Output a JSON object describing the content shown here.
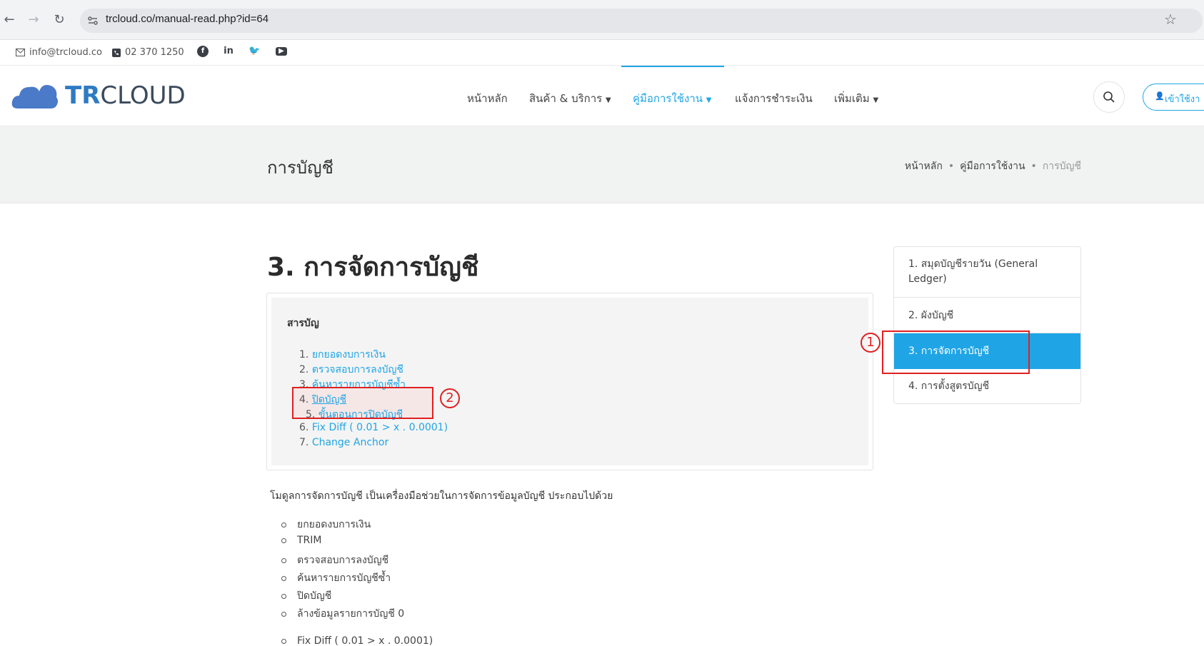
{
  "browser": {
    "url": "trcloud.co/manual-read.php?id=64"
  },
  "topbar": {
    "email": "info@trcloud.co",
    "phone": "02 370 1250",
    "social_icons": [
      "facebook-icon",
      "linkedin-icon",
      "twitter-icon",
      "youtube-icon"
    ]
  },
  "header": {
    "logo_tr": "TR",
    "logo_cloud": "CLOUD",
    "menu": [
      {
        "label": "หน้าหลัก",
        "dropdown": false
      },
      {
        "label": "สินค้า & บริการ",
        "dropdown": true
      },
      {
        "label": "คู่มือการใช้งาน",
        "dropdown": true,
        "active": true
      },
      {
        "label": "แจ้งการชำระเงิน",
        "dropdown": false
      },
      {
        "label": "เพิ่มเติม",
        "dropdown": true
      }
    ],
    "login_label": "เข้าใช้งา"
  },
  "page": {
    "title": "การบัญชี",
    "breadcrumb": [
      "หน้าหลัก",
      "คู่มือการใช้งาน",
      "การบัญชี"
    ]
  },
  "main": {
    "heading": "3. การจัดการบัญชี",
    "toc_title": "สารบัญ",
    "toc": [
      {
        "num": "1.",
        "label": "ยกยอดงบการเงิน"
      },
      {
        "num": "2.",
        "label": "ตรวจสอบการลงบัญชี"
      },
      {
        "num": "3.",
        "label": "ค้นหารายการบัญชีซ้ำ"
      },
      {
        "num": "4.",
        "label": "ปิดบัญชี"
      },
      {
        "num": "5.",
        "label": "ขั้นตอนการปิดบัญชี"
      },
      {
        "num": "6.",
        "label": "Fix Diff ( 0.01 > x . 0.0001)"
      },
      {
        "num": "7.",
        "label": "Change Anchor"
      }
    ],
    "intro": "โมดูลการจัดการบัญชี เป็นเครื่องมือช่วยในการจัดการข้อมูลบัญชี ประกอบไปด้วย",
    "bullets": [
      "ยกยอดงบการเงิน",
      "TRIM",
      "ตรวจสอบการลงบัญชี",
      "ค้นหารายการบัญชีซ้ำ",
      "ปิดบัญชี",
      "ล้างข้อมูลรายการบัญชี 0",
      "Fix Diff ( 0.01 > x . 0.0001)"
    ]
  },
  "sidebar": {
    "items": [
      {
        "label": "1. สมุดบัญชีรายวัน (General Ledger)"
      },
      {
        "label": "2. ผังบัญชี"
      },
      {
        "label": "3. การจัดการบัญชี",
        "active": true
      },
      {
        "label": "4. การตั้งสูตรบัญชี"
      }
    ]
  },
  "annotations": {
    "marker_1": "1",
    "marker_2": "2",
    "color": "#e02020"
  },
  "colors": {
    "accent": "#1fa5e6",
    "annotation": "#e02020"
  }
}
